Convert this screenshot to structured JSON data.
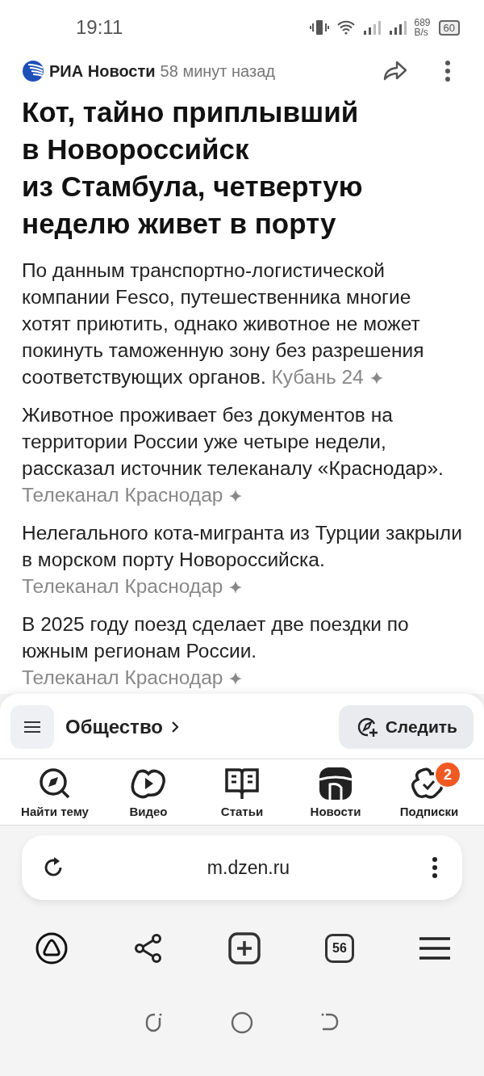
{
  "status_bar": {
    "time": "19:11",
    "speed_value": "689",
    "speed_unit": "B/s",
    "battery": "60"
  },
  "header": {
    "source": "РИА Новости",
    "time": "58 минут назад"
  },
  "title": "Кот, тайно приплывший\nв Новороссийск\nиз Стамбула, четвертую\nнеделю живет в порту",
  "paragraphs": [
    {
      "text": "По данным транспортно-логистической компании Fesco, путешественника многие хотят приютить, однако животное не может покинуть таможенную зону без разрешения соответствующих органов.",
      "source": "Кубань 24"
    },
    {
      "text": "Животное проживает без документов на территории России уже четыре недели, рассказал источник телеканалу «Краснодар».",
      "source": "Телеканал Краснодар"
    },
    {
      "text": "Нелегального кота-мигранта из Турции закрыли в морском порту Новороссийска.",
      "source": "Телеканал Краснодар"
    },
    {
      "text": "В 2025 году поезд сделает две поездки по южным регионам России.",
      "source": "Телеканал Краснодар"
    }
  ],
  "topic": {
    "label": "Общество",
    "follow": "Следить"
  },
  "nav": [
    {
      "label": "Найти тему"
    },
    {
      "label": "Видео"
    },
    {
      "label": "Статьи"
    },
    {
      "label": "Новости"
    },
    {
      "label": "Подписки",
      "badge": "2"
    }
  ],
  "browser": {
    "url": "m.dzen.ru",
    "tabs_count": "56"
  }
}
